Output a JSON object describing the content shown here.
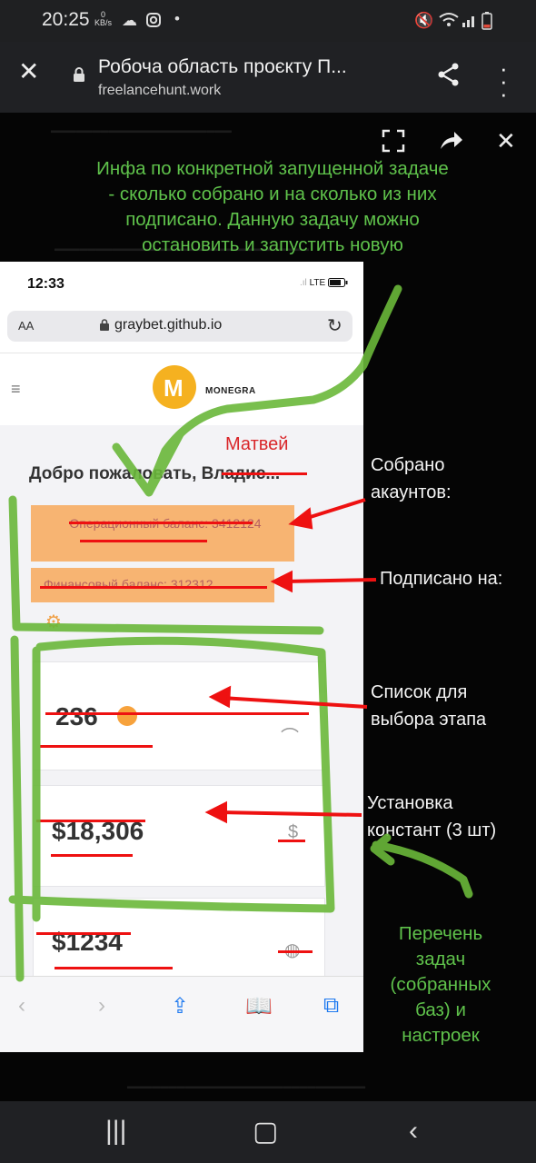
{
  "status_bar": {
    "time": "20:25",
    "net_speed_value": "0",
    "net_speed_unit": "KB/s",
    "icons": [
      "cloud-icon",
      "instagram-icon",
      "dot-icon",
      "mute-icon",
      "wifi-icon",
      "signal-icon",
      "battery-icon"
    ]
  },
  "header": {
    "title": "Робоча область проєкту П...",
    "url": "freelancehunt.work",
    "close_icon": "close-icon",
    "share_icon": "share-icon",
    "more_icon": "more-vertical-icon"
  },
  "viewer": {
    "controls": [
      "fullscreen-icon",
      "forward-icon",
      "close-icon"
    ],
    "top_green_note": "Инфа по конкретной запущенной задаче\n- сколько собрано и на сколько из них\nподписано. Данную задачу можно\nостановить и запустить новую",
    "annotations": {
      "collected": "Собрано\nакаунтов:",
      "subscribed": "Подписано на:",
      "stage_list": "Список для\nвыбора этапа",
      "constants": "Установка\nконстант (3 шт)",
      "tasks_list": "Перечень\nзадач\n(собранных\nбаз) и\nнастроек"
    }
  },
  "phone": {
    "time": "12:33",
    "network": "LTE",
    "aa": "AA",
    "domain": "graybet.github.io",
    "logo_text": "MONEGRA",
    "handwritten_name": "Матвей",
    "welcome": "Добро пожаловать, Владис...",
    "balance1": "Операционный баланс: 3412124",
    "balance2": "Финансовый баланс: 312312",
    "cards": [
      {
        "value": "236"
      },
      {
        "value": "$18,306"
      },
      {
        "value": "$1234"
      }
    ]
  },
  "colors": {
    "annotation_green": "#5fc24b",
    "marker_green": "#6ab83a",
    "marker_red": "#ee1111",
    "balance_orange": "#f7b472",
    "logo_gold": "#f5b120"
  }
}
